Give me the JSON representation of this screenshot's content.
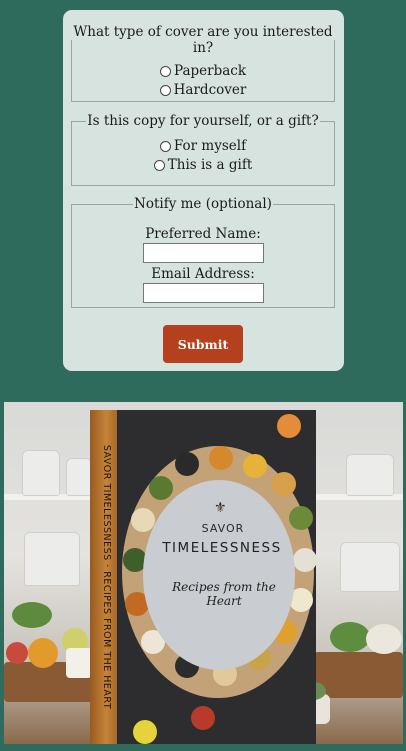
{
  "form": {
    "cover_question": "What type of cover are you interested in?",
    "cover_options": [
      "Paperback",
      "Hardcover"
    ],
    "recipient_question": "Is this copy for yourself, or a gift?",
    "recipient_options": [
      "For myself",
      "This is a gift"
    ],
    "notify_legend": "Notify me (optional)",
    "name_label": "Preferred Name:",
    "name_value": "",
    "email_label": "Email Address:",
    "email_value": "",
    "submit_label": "Submit"
  },
  "product": {
    "spine_text": "SAVOR TIMELESSNESS · RECIPES FROM THE HEART",
    "cover_title_line1": "SAVOR",
    "cover_title_line2": "TIMELESSNESS",
    "cover_subtitle": "Recipes from the Heart",
    "emblem_icon": "fleur-de-lis-icon"
  },
  "colors": {
    "page_background": "#2e6b5c",
    "card_background": "#d7e3de",
    "submit_button": "#b5401e",
    "book_spine": "#c58438"
  }
}
